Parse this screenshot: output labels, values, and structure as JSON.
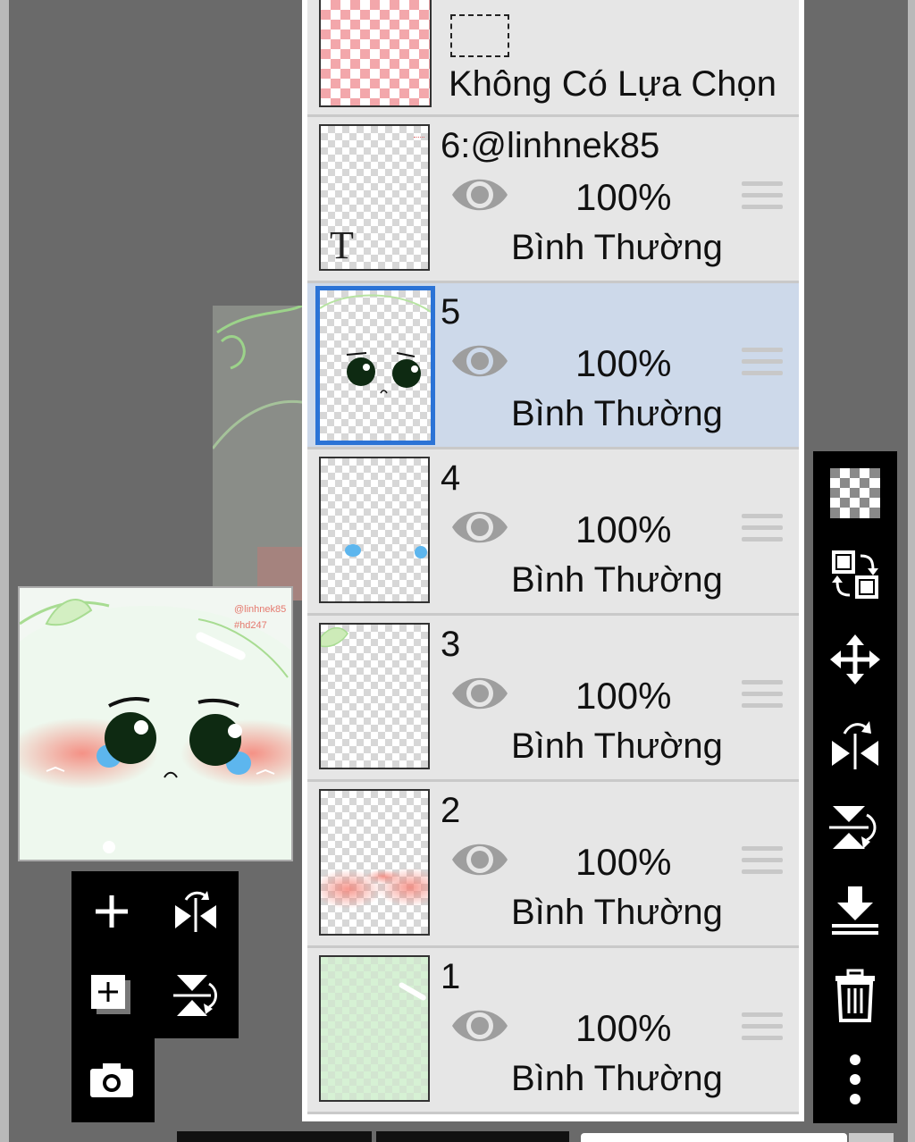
{
  "selection": {
    "label": "Không Có Lựa Chọn"
  },
  "layers": [
    {
      "name": "6:@linhnek85",
      "opacity": "100%",
      "blend": "Bình Thường",
      "selected": false,
      "type": "text"
    },
    {
      "name": "5",
      "opacity": "100%",
      "blend": "Bình Thường",
      "selected": true
    },
    {
      "name": "4",
      "opacity": "100%",
      "blend": "Bình Thường",
      "selected": false
    },
    {
      "name": "3",
      "opacity": "100%",
      "blend": "Bình Thường",
      "selected": false
    },
    {
      "name": "2",
      "opacity": "100%",
      "blend": "Bình Thường",
      "selected": false
    },
    {
      "name": "1",
      "opacity": "100%",
      "blend": "Bình Thường",
      "selected": false
    }
  ],
  "preview": {
    "watermark_line1": "@linhnek85",
    "watermark_line2": "#hd247"
  },
  "icons": {
    "left_toolbar": [
      "plus-icon",
      "flip-horizontal-icon",
      "add-layer-icon",
      "flip-vertical-icon",
      "camera-icon"
    ],
    "right_toolbar": [
      "transparency-icon",
      "swap-layer-icon",
      "move-icon",
      "flip-horizontal-icon",
      "flip-vertical-icon",
      "merge-down-icon",
      "trash-icon",
      "more-icon"
    ]
  },
  "colors": {
    "selected_row": "#cdd9ea",
    "selected_border": "#2b73d6",
    "panel_bg": "#e6e6e6"
  }
}
